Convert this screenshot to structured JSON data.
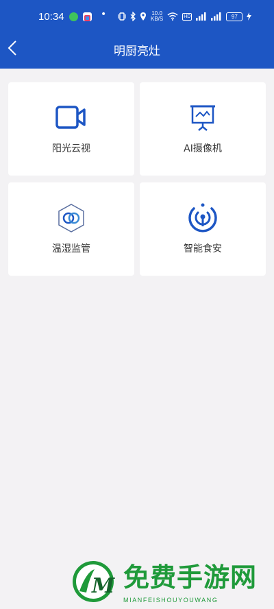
{
  "status_bar": {
    "time": "10:34",
    "dot": "•",
    "net_speed_top": "10.0",
    "net_speed_bottom": "KB/S",
    "hd_label": "HD",
    "battery": "97",
    "icons": [
      "wechat-icon",
      "app-icon",
      "vibrate-icon",
      "bluetooth-icon",
      "location-icon",
      "wifi-icon",
      "signal-icon",
      "signal-icon",
      "charging-icon"
    ]
  },
  "nav": {
    "back_icon": "chevron-left-icon",
    "title": "明厨亮灶"
  },
  "tiles": [
    {
      "label": "阳光云视",
      "icon": "video-camera-icon"
    },
    {
      "label": "AI摄像机",
      "icon": "monitor-stand-icon"
    },
    {
      "label": "温湿监管",
      "icon": "hexagon-rings-icon"
    },
    {
      "label": "智能食安",
      "icon": "broadcast-tower-icon"
    }
  ],
  "colors": {
    "header": "#1d56c4",
    "accent": "#1d56c4",
    "background": "#f3f2f4",
    "watermark": "#1f9a3a"
  },
  "watermark": {
    "logo_letter": "M",
    "title": "免费手游网",
    "subtitle": "MIANFEISHOUYOUWANG"
  }
}
